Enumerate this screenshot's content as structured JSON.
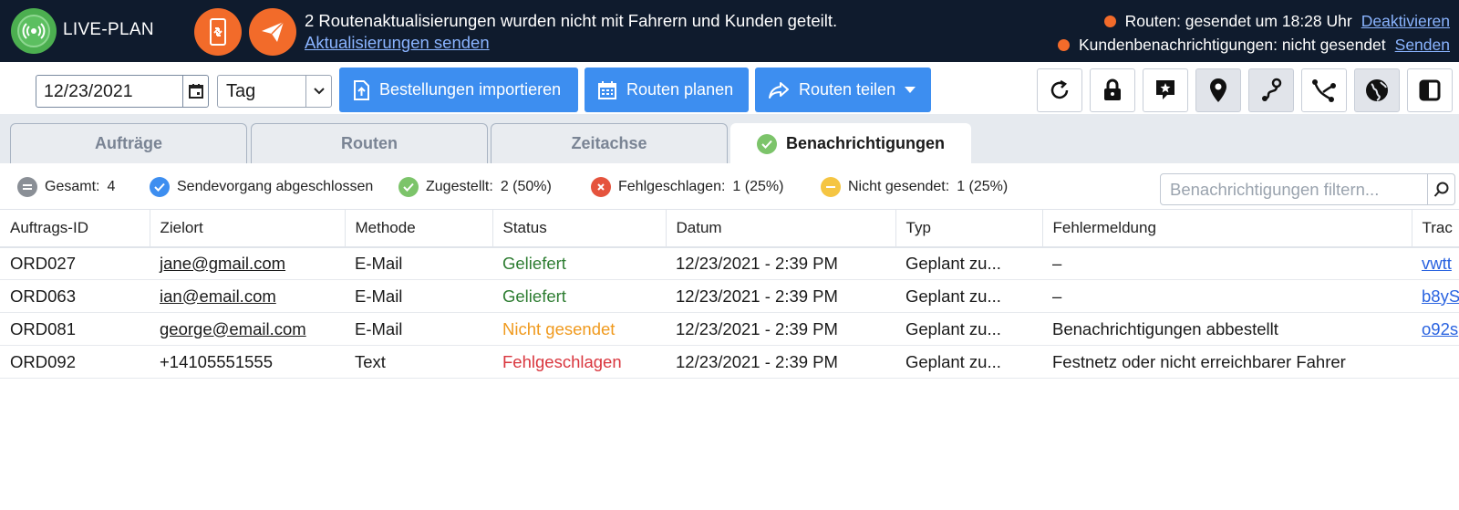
{
  "header": {
    "app_label": "LIVE-PLAN",
    "notice": "2 Routenaktualisierungen wurden nicht mit Fahrern und Kunden geteilt.",
    "notice_link": "Aktualisierungen senden",
    "status_routes": "Routen: gesendet um 18:28 Uhr",
    "status_routes_link": "Deaktivieren",
    "status_customers": "Kundenbenachrichtigungen: nicht gesendet",
    "status_customers_link": "Senden"
  },
  "toolbar": {
    "date_value": "12/23/2021",
    "period_value": "Tag",
    "import_label": "Bestellungen importieren",
    "plan_label": "Routen planen",
    "share_label": "Routen teilen"
  },
  "tabs": [
    {
      "label": "Aufträge"
    },
    {
      "label": "Routen"
    },
    {
      "label": "Zeitachse"
    },
    {
      "label": "Benachrichtigungen"
    }
  ],
  "summary": {
    "total_label": "Gesamt:",
    "total_value": "4",
    "complete_label": "Sendevorgang abgeschlossen",
    "delivered_label": "Zugestellt:",
    "delivered_value": "2 (50%)",
    "failed_label": "Fehlgeschlagen:",
    "failed_value": "1 (25%)",
    "notsent_label": "Nicht gesendet:",
    "notsent_value": "1 (25%)",
    "filter_placeholder": "Benachrichtigungen filtern..."
  },
  "table": {
    "columns": [
      "Auftrags-ID",
      "Zielort",
      "Methode",
      "Status",
      "Datum",
      "Typ",
      "Fehlermeldung",
      "Trac"
    ],
    "rows": [
      {
        "id": "ORD027",
        "dest": "jane@gmail.com",
        "method": "E-Mail",
        "status": "Geliefert",
        "date": "12/23/2021 - 2:39 PM",
        "type": "Geplant zu...",
        "error": "–",
        "tracking": "vwtt"
      },
      {
        "id": "ORD063",
        "dest": "ian@email.com",
        "method": "E-Mail",
        "status": "Geliefert",
        "date": "12/23/2021 - 2:39 PM",
        "type": "Geplant zu...",
        "error": "–",
        "tracking": "b8yS"
      },
      {
        "id": "ORD081",
        "dest": "george@email.com",
        "method": "E-Mail",
        "status": "Nicht gesendet",
        "date": "12/23/2021 - 2:39 PM",
        "type": "Geplant zu...",
        "error": "Benachrichtigungen abbestellt",
        "tracking": "o92s"
      },
      {
        "id": "ORD092",
        "dest": "+14105551555",
        "method": "Text",
        "status": "Fehlgeschlagen",
        "date": "12/23/2021 - 2:39 PM",
        "type": "Geplant zu...",
        "error": "Festnetz oder nicht erreichbarer Fahrer",
        "tracking": ""
      }
    ]
  },
  "colors": {
    "header_bg": "#0f1b2d",
    "accent_orange": "#f26b2a",
    "button_blue": "#3d8ef0",
    "status_delivered": "#2e7d32",
    "status_not_sent": "#f09a1e",
    "status_failed": "#d9363e"
  },
  "icons": {
    "live": "broadcast-icon",
    "mobile_update": "phone-sync-icon",
    "send": "paper-plane-icon",
    "calendar": "calendar-icon",
    "refresh": "refresh-icon",
    "lock": "lock-icon",
    "star_message": "star-message-icon",
    "pin": "map-pin-icon",
    "route": "route-icon",
    "route_alt": "route-branch-icon",
    "globe": "globe-icon",
    "panel": "panel-icon"
  }
}
